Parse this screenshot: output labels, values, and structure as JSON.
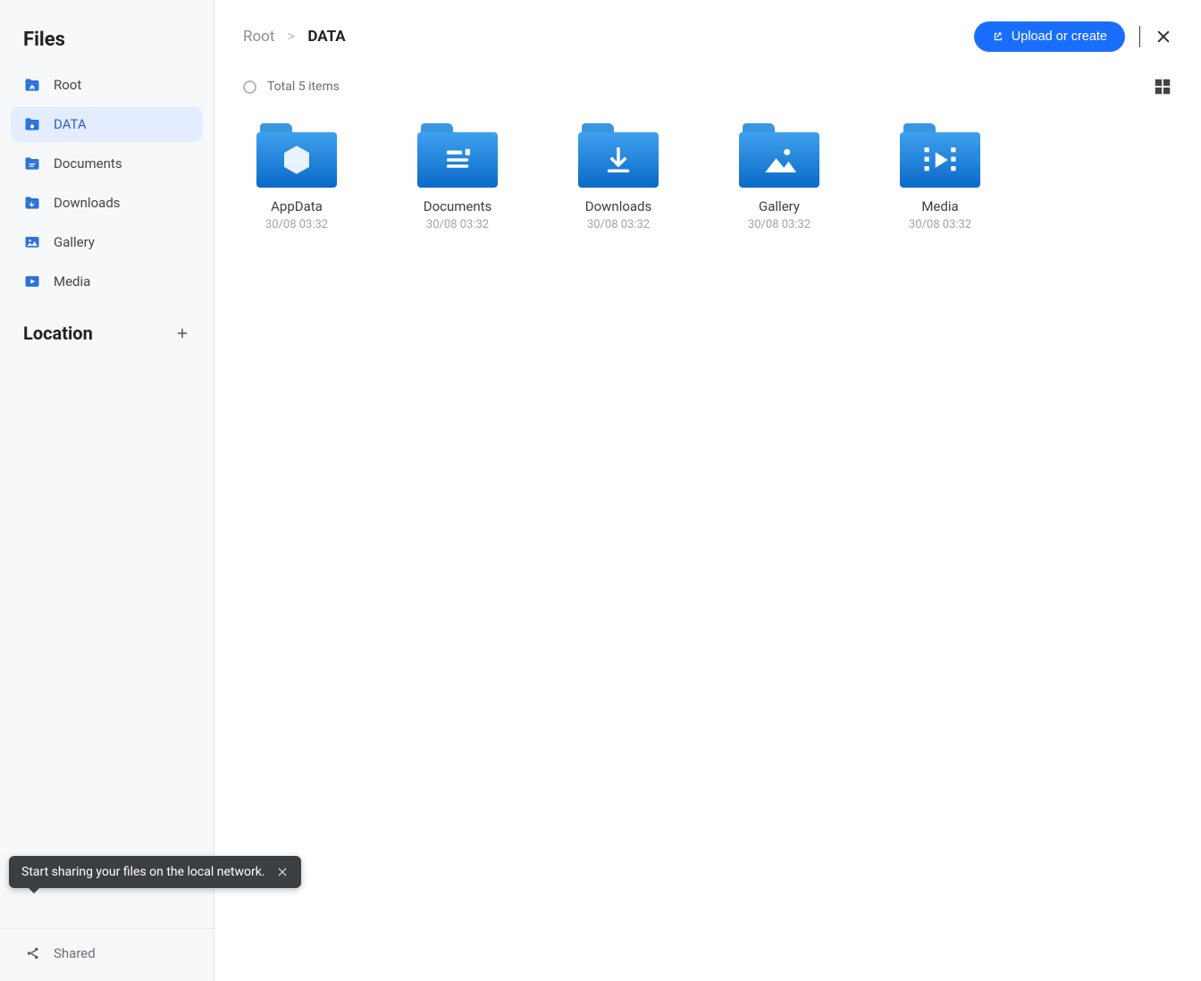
{
  "sidebar": {
    "title": "Files",
    "items": [
      {
        "label": "Root",
        "icon": "home-folder-icon"
      },
      {
        "label": "DATA",
        "icon": "data-folder-icon"
      },
      {
        "label": "Documents",
        "icon": "document-folder-icon"
      },
      {
        "label": "Downloads",
        "icon": "download-folder-icon"
      },
      {
        "label": "Gallery",
        "icon": "gallery-folder-icon"
      },
      {
        "label": "Media",
        "icon": "media-folder-icon"
      }
    ],
    "active_index": 1,
    "location_label": "Location",
    "shared_label": "Shared"
  },
  "tooltip": {
    "text": "Start sharing your files on the local network."
  },
  "breadcrumb": {
    "root": "Root",
    "current": "DATA"
  },
  "upload_label": "Upload or create",
  "status": {
    "total": "Total 5 items"
  },
  "items": [
    {
      "name": "AppData",
      "date": "30/08 03:32",
      "icon": "cube"
    },
    {
      "name": "Documents",
      "date": "30/08 03:32",
      "icon": "doc"
    },
    {
      "name": "Downloads",
      "date": "30/08 03:32",
      "icon": "download"
    },
    {
      "name": "Gallery",
      "date": "30/08 03:32",
      "icon": "gallery"
    },
    {
      "name": "Media",
      "date": "30/08 03:32",
      "icon": "media"
    }
  ]
}
